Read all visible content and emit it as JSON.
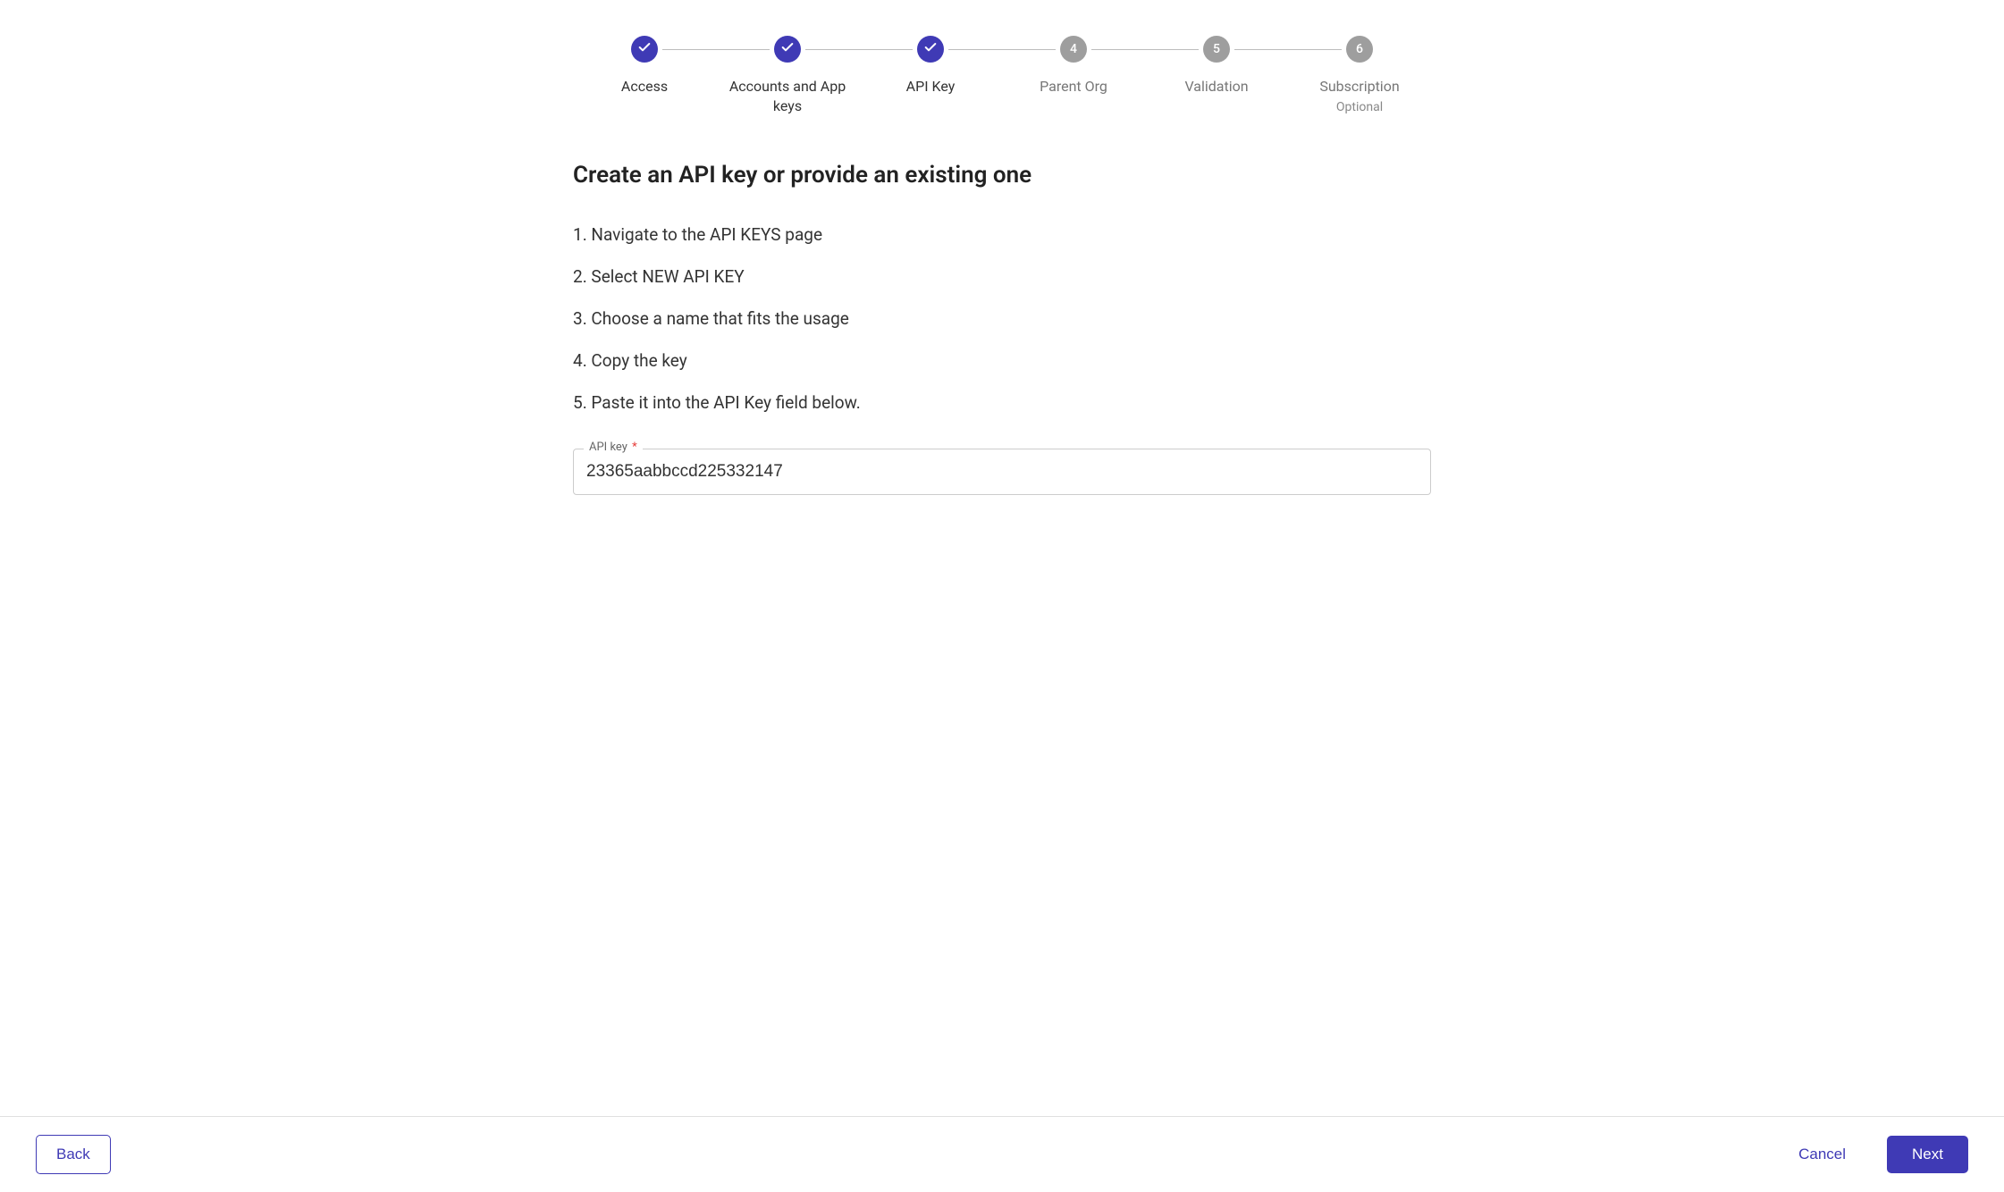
{
  "stepper": {
    "steps": [
      {
        "label": "Access",
        "status": "completed"
      },
      {
        "label": "Accounts and App keys",
        "status": "completed"
      },
      {
        "label": "API Key",
        "status": "completed"
      },
      {
        "label": "Parent Org",
        "status": "pending",
        "number": "4"
      },
      {
        "label": "Validation",
        "status": "pending",
        "number": "5"
      },
      {
        "label": "Subscription",
        "status": "pending",
        "number": "6",
        "sublabel": "Optional"
      }
    ]
  },
  "content": {
    "title": "Create an API key or provide an existing one",
    "instructions": [
      "Navigate to the API KEYS page",
      "Select NEW API KEY",
      "Choose a name that fits the usage",
      "Copy the key",
      "Paste it into the API Key field below."
    ]
  },
  "field": {
    "label": "API key",
    "required_marker": "*",
    "value": "23365aabbccd225332147"
  },
  "footer": {
    "back": "Back",
    "cancel": "Cancel",
    "next": "Next"
  }
}
